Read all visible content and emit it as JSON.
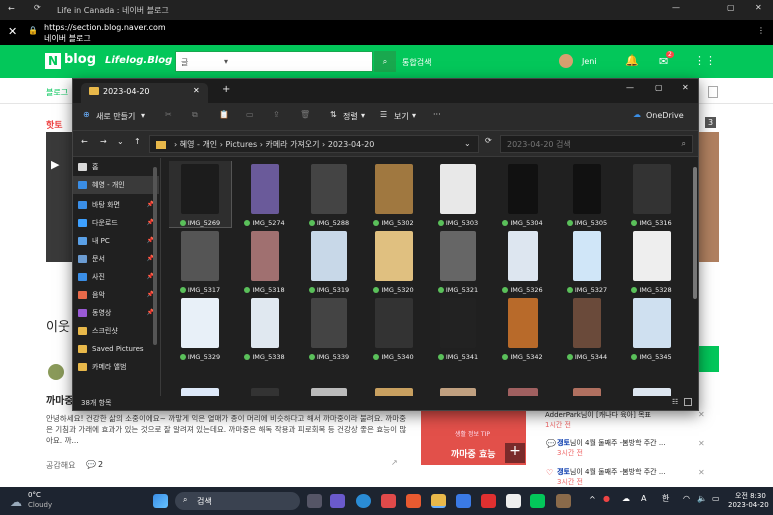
{
  "browser": {
    "tab_title": "Life in Canada : 네이버 블로그",
    "url": "https://section.blog.naver.com",
    "site": "네이버 블로그"
  },
  "naver": {
    "logo": "N",
    "blog_word": "blog",
    "lifelog": "Lifelog.Blog",
    "search_scope": "글",
    "search_button": "통합검색",
    "username": "Jeni",
    "mail_badge": "2",
    "home_link": "블로그",
    "hot_topic": "핫토",
    "page_count": "3",
    "left_title": "이웃",
    "post_title": "까마중",
    "post_text": "안녕하세요! 건강한 삶의 소중이에요~ 까맣게 익은 열매가 종이 머리에 비슷하다고 해서 까마중이라 불려요. 까마중은 기침과 가래에 효과가 있는 것으로 잘 알려져 있는데요. 까마중은 해독 작용과 피로회복 등 건강상 좋은 효능이 많아요. 까...",
    "like": "공감해요",
    "comments": "2",
    "banner_tip": "생활 정보 TIP",
    "banner_title": "까마중 효능",
    "notifications": [
      {
        "name": "",
        "text": "AdderPark님이 [캐나다 육아] 목표",
        "time": "1시간 전"
      },
      {
        "name": "갱토",
        "text": "님이 4월 둘째주 -봄방학 주간 ...",
        "time": "3시간 전"
      },
      {
        "name": "갱토",
        "text": "님이 4월 둘째주 -봄방학 주간 ...",
        "time": "3시간 전"
      }
    ]
  },
  "explorer": {
    "tab_title": "2023-04-20",
    "new_button": "새로 만들기",
    "sort_button": "정렬",
    "view_button": "보기",
    "more": "···",
    "onedrive": "OneDrive",
    "path": [
      "혜영 - 개인",
      "Pictures",
      "카메라 가져오기",
      "2023-04-20"
    ],
    "search_placeholder": "2023-04-20 검색",
    "status": "38개 항목",
    "sidebar": [
      {
        "label": "홈",
        "icon": "home-icon",
        "color": "#d9d9d9"
      },
      {
        "label": "혜영 - 개인",
        "icon": "onedrive-icon",
        "color": "#3a8ee6"
      },
      {
        "label": "바탕 화면",
        "icon": "desktop-icon",
        "color": "#3a8ee6"
      },
      {
        "label": "다운로드",
        "icon": "download-icon",
        "color": "#3da0ff"
      },
      {
        "label": "내 PC",
        "icon": "pc-icon",
        "color": "#5aa0e6"
      },
      {
        "label": "문서",
        "icon": "documents-icon",
        "color": "#6b9bd1"
      },
      {
        "label": "사진",
        "icon": "pictures-icon",
        "color": "#3a8ee6"
      },
      {
        "label": "음악",
        "icon": "music-icon",
        "color": "#e86a4a"
      },
      {
        "label": "동영상",
        "icon": "video-icon",
        "color": "#9a5ad6"
      },
      {
        "label": "스크린샷",
        "icon": "folder-icon",
        "color": "#e8b84a"
      },
      {
        "label": "Saved Pictures",
        "icon": "folder-icon",
        "color": "#e8b84a"
      },
      {
        "label": "카메라 앨범",
        "icon": "folder-icon",
        "color": "#e8b84a"
      }
    ],
    "files": [
      {
        "name": "IMG_5269",
        "color": "#1c1c1c"
      },
      {
        "name": "IMG_5274",
        "color": "#6a5a9a"
      },
      {
        "name": "IMG_5288",
        "color": "#444"
      },
      {
        "name": "IMG_5302",
        "color": "#a07840"
      },
      {
        "name": "IMG_5303",
        "color": "#e8e8e8"
      },
      {
        "name": "IMG_5304",
        "color": "#111"
      },
      {
        "name": "IMG_5305",
        "color": "#111"
      },
      {
        "name": "IMG_5316",
        "color": "#333"
      },
      {
        "name": "IMG_5317",
        "color": "#555"
      },
      {
        "name": "IMG_5318",
        "color": "#a07070"
      },
      {
        "name": "IMG_5319",
        "color": "#c8d8e8"
      },
      {
        "name": "IMG_5320",
        "color": "#e0c080"
      },
      {
        "name": "IMG_5321",
        "color": "#666"
      },
      {
        "name": "IMG_5326",
        "color": "#dde6f0"
      },
      {
        "name": "IMG_5327",
        "color": "#d0e6f8"
      },
      {
        "name": "IMG_5328",
        "color": "#eeeeee"
      },
      {
        "name": "IMG_5329",
        "color": "#e8f0f8"
      },
      {
        "name": "IMG_5338",
        "color": "#e0e8f0"
      },
      {
        "name": "IMG_5339",
        "color": "#444"
      },
      {
        "name": "IMG_5340",
        "color": "#333"
      },
      {
        "name": "IMG_5341",
        "color": "#222"
      },
      {
        "name": "IMG_5342",
        "color": "#b86a2a"
      },
      {
        "name": "IMG_5344",
        "color": "#6a4a3a"
      },
      {
        "name": "IMG_5345",
        "color": "#cfe0f0"
      },
      {
        "name": "",
        "color": "#dde8f8"
      },
      {
        "name": "",
        "color": "#333"
      },
      {
        "name": "",
        "color": "#bbb"
      },
      {
        "name": "",
        "color": "#c8a060"
      },
      {
        "name": "",
        "color": "#c0a080"
      },
      {
        "name": "",
        "color": "#a06060"
      },
      {
        "name": "",
        "color": "#b07060"
      },
      {
        "name": "",
        "color": "#dde6f0"
      }
    ]
  },
  "taskbar": {
    "temp": "0°C",
    "weather": "Cloudy",
    "search": "검색",
    "lang": "A",
    "ime": "한",
    "time": "오전 8:30",
    "date": "2023-04-20"
  }
}
